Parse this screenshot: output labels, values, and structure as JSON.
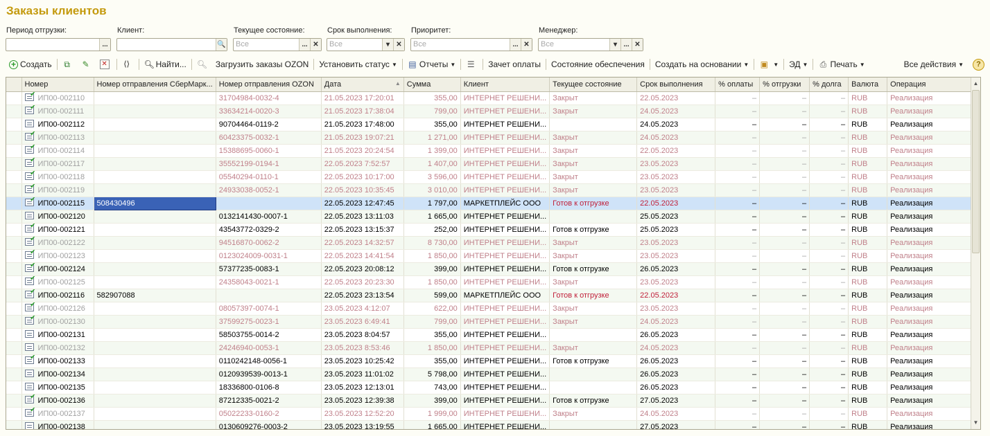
{
  "page": {
    "title": "Заказы клиентов"
  },
  "filters": [
    {
      "label": "Период отгрузки:",
      "value": "",
      "buttons": [
        "..."
      ]
    },
    {
      "label": "Клиент:",
      "value": "",
      "buttons": [
        "🔍"
      ]
    },
    {
      "label": "Текущее состояние:",
      "value": "Все",
      "buttons": [
        "...",
        "✕"
      ]
    },
    {
      "label": "Срок выполнения:",
      "value": "Все",
      "buttons": [
        "▾",
        "✕"
      ]
    },
    {
      "label": "Приоритет:",
      "value": "Все",
      "buttons": [
        "...",
        "✕"
      ]
    },
    {
      "label": "Менеджер:",
      "value": "Все",
      "buttons": [
        "▾",
        "...",
        "✕"
      ]
    }
  ],
  "toolbar": {
    "create": "Создать",
    "find": "Найти...",
    "load_ozon": "Загрузить заказы OZON",
    "set_status": "Установить статус",
    "reports": "Отчеты",
    "payment_offset": "Зачет оплаты",
    "supply_state": "Состояние обеспечения",
    "create_based": "Создать на основании",
    "ed": "ЭД",
    "print": "Печать",
    "all_actions": "Все действия",
    "help": "?"
  },
  "table": {
    "columns": [
      "Номер",
      "Номер отправления СберМарк...",
      "Номер отправления OZON",
      "Дата",
      "Сумма",
      "Клиент",
      "Текущее состояние",
      "Срок выполнения",
      "% оплаты",
      "% отгрузки",
      "% долга",
      "Валюта",
      "Операция"
    ],
    "rows": [
      {
        "icon": "done",
        "state": "gray",
        "number": "ИП00-002110",
        "sber": "",
        "ozon": "31704984-0032-4",
        "date": "21.05.2023 17:20:01",
        "sum": "355,00",
        "client": "ИНТЕРНЕТ РЕШЕНИ...",
        "status": "Закрыт",
        "due": "22.05.2023",
        "pay": "–",
        "ship": "–",
        "debt": "–",
        "currency": "RUB",
        "operation": "Реализация"
      },
      {
        "icon": "done",
        "state": "gray",
        "number": "ИП00-002111",
        "sber": "",
        "ozon": "33634214-0020-3",
        "date": "21.05.2023 17:38:04",
        "sum": "799,00",
        "client": "ИНТЕРНЕТ РЕШЕНИ...",
        "status": "Закрыт",
        "due": "24.05.2023",
        "pay": "–",
        "ship": "–",
        "debt": "–",
        "currency": "RUB",
        "operation": "Реализация"
      },
      {
        "icon": "doc",
        "state": "normal",
        "number": "ИП00-002112",
        "sber": "",
        "ozon": "90704464-0119-2",
        "date": "21.05.2023 17:48:00",
        "sum": "355,00",
        "client": "ИНТЕРНЕТ РЕШЕНИ...",
        "status": "",
        "due": "24.05.2023",
        "pay": "–",
        "ship": "–",
        "debt": "–",
        "currency": "RUB",
        "operation": "Реализация"
      },
      {
        "icon": "done",
        "state": "gray",
        "number": "ИП00-002113",
        "sber": "",
        "ozon": "60423375-0032-1",
        "date": "21.05.2023 19:07:21",
        "sum": "1 271,00",
        "client": "ИНТЕРНЕТ РЕШЕНИ...",
        "status": "Закрыт",
        "due": "24.05.2023",
        "pay": "–",
        "ship": "–",
        "debt": "–",
        "currency": "RUB",
        "operation": "Реализация"
      },
      {
        "icon": "done",
        "state": "gray",
        "number": "ИП00-002114",
        "sber": "",
        "ozon": "15388695-0060-1",
        "date": "21.05.2023 20:24:54",
        "sum": "1 399,00",
        "client": "ИНТЕРНЕТ РЕШЕНИ...",
        "status": "Закрыт",
        "due": "22.05.2023",
        "pay": "–",
        "ship": "–",
        "debt": "–",
        "currency": "RUB",
        "operation": "Реализация"
      },
      {
        "icon": "done",
        "state": "gray",
        "number": "ИП00-002117",
        "sber": "",
        "ozon": "35552199-0194-1",
        "date": "22.05.2023 7:52:57",
        "sum": "1 407,00",
        "client": "ИНТЕРНЕТ РЕШЕНИ...",
        "status": "Закрыт",
        "due": "23.05.2023",
        "pay": "–",
        "ship": "–",
        "debt": "–",
        "currency": "RUB",
        "operation": "Реализация"
      },
      {
        "icon": "done",
        "state": "gray",
        "number": "ИП00-002118",
        "sber": "",
        "ozon": "05540294-0110-1",
        "date": "22.05.2023 10:17:00",
        "sum": "3 596,00",
        "client": "ИНТЕРНЕТ РЕШЕНИ...",
        "status": "Закрыт",
        "due": "23.05.2023",
        "pay": "–",
        "ship": "–",
        "debt": "–",
        "currency": "RUB",
        "operation": "Реализация"
      },
      {
        "icon": "done",
        "state": "gray",
        "number": "ИП00-002119",
        "sber": "",
        "ozon": "24933038-0052-1",
        "date": "22.05.2023 10:35:45",
        "sum": "3 010,00",
        "client": "ИНТЕРНЕТ РЕШЕНИ...",
        "status": "Закрыт",
        "due": "23.05.2023",
        "pay": "–",
        "ship": "–",
        "debt": "–",
        "currency": "RUB",
        "operation": "Реализация"
      },
      {
        "icon": "done",
        "state": "selected",
        "number": "ИП00-002115",
        "sber": "508430496",
        "ozon": "",
        "date": "22.05.2023 12:47:45",
        "sum": "1 797,00",
        "client": "МАРКЕТПЛЕЙС ООО",
        "status": "Готов к отгрузке",
        "due": "22.05.2023",
        "red": true,
        "pay": "–",
        "ship": "–",
        "debt": "–",
        "currency": "RUB",
        "operation": "Реализация"
      },
      {
        "icon": "doc",
        "state": "normal",
        "number": "ИП00-002120",
        "sber": "",
        "ozon": "0132141430-0007-1",
        "date": "22.05.2023 13:11:03",
        "sum": "1 665,00",
        "client": "ИНТЕРНЕТ РЕШЕНИ...",
        "status": "",
        "due": "25.05.2023",
        "pay": "–",
        "ship": "–",
        "debt": "–",
        "currency": "RUB",
        "operation": "Реализация"
      },
      {
        "icon": "done",
        "state": "normal",
        "number": "ИП00-002121",
        "sber": "",
        "ozon": "43543772-0329-2",
        "date": "22.05.2023 13:15:37",
        "sum": "252,00",
        "client": "ИНТЕРНЕТ РЕШЕНИ...",
        "status": "Готов к отгрузке",
        "due": "25.05.2023",
        "pay": "–",
        "ship": "–",
        "debt": "–",
        "currency": "RUB",
        "operation": "Реализация"
      },
      {
        "icon": "done",
        "state": "gray",
        "number": "ИП00-002122",
        "sber": "",
        "ozon": "94516870-0062-2",
        "date": "22.05.2023 14:32:57",
        "sum": "8 730,00",
        "client": "ИНТЕРНЕТ РЕШЕНИ...",
        "status": "Закрыт",
        "due": "23.05.2023",
        "pay": "–",
        "ship": "–",
        "debt": "–",
        "currency": "RUB",
        "operation": "Реализация"
      },
      {
        "icon": "done",
        "state": "gray",
        "number": "ИП00-002123",
        "sber": "",
        "ozon": "0123024009-0031-1",
        "date": "22.05.2023 14:41:54",
        "sum": "1 850,00",
        "client": "ИНТЕРНЕТ РЕШЕНИ...",
        "status": "Закрыт",
        "due": "23.05.2023",
        "pay": "–",
        "ship": "–",
        "debt": "–",
        "currency": "RUB",
        "operation": "Реализация"
      },
      {
        "icon": "done",
        "state": "normal",
        "number": "ИП00-002124",
        "sber": "",
        "ozon": "57377235-0083-1",
        "date": "22.05.2023 20:08:12",
        "sum": "399,00",
        "client": "ИНТЕРНЕТ РЕШЕНИ...",
        "status": "Готов к отгрузке",
        "due": "26.05.2023",
        "pay": "–",
        "ship": "–",
        "debt": "–",
        "currency": "RUB",
        "operation": "Реализация"
      },
      {
        "icon": "done",
        "state": "gray",
        "number": "ИП00-002125",
        "sber": "",
        "ozon": "24358043-0021-1",
        "date": "22.05.2023 20:23:30",
        "sum": "1 850,00",
        "client": "ИНТЕРНЕТ РЕШЕНИ...",
        "status": "Закрыт",
        "due": "23.05.2023",
        "pay": "–",
        "ship": "–",
        "debt": "–",
        "currency": "RUB",
        "operation": "Реализация"
      },
      {
        "icon": "done",
        "state": "normal",
        "number": "ИП00-002116",
        "sber": "582907088",
        "ozon": "",
        "date": "22.05.2023 23:13:54",
        "sum": "599,00",
        "client": "МАРКЕТПЛЕЙС ООО",
        "status": "Готов к отгрузке",
        "due": "22.05.2023",
        "red": true,
        "pay": "–",
        "ship": "–",
        "debt": "–",
        "currency": "RUB",
        "operation": "Реализация"
      },
      {
        "icon": "done",
        "state": "gray",
        "number": "ИП00-002126",
        "sber": "",
        "ozon": "08057397-0074-1",
        "date": "23.05.2023 4:12:07",
        "sum": "622,00",
        "client": "ИНТЕРНЕТ РЕШЕНИ...",
        "status": "Закрыт",
        "due": "23.05.2023",
        "pay": "–",
        "ship": "–",
        "debt": "–",
        "currency": "RUB",
        "operation": "Реализация"
      },
      {
        "icon": "done",
        "state": "gray",
        "number": "ИП00-002130",
        "sber": "",
        "ozon": "37599275-0023-1",
        "date": "23.05.2023 6:49:41",
        "sum": "799,00",
        "client": "ИНТЕРНЕТ РЕШЕНИ...",
        "status": "Закрыт",
        "due": "24.05.2023",
        "pay": "–",
        "ship": "–",
        "debt": "–",
        "currency": "RUB",
        "operation": "Реализация"
      },
      {
        "icon": "doc",
        "state": "normal",
        "number": "ИП00-002131",
        "sber": "",
        "ozon": "58503755-0014-2",
        "date": "23.05.2023 8:04:57",
        "sum": "355,00",
        "client": "ИНТЕРНЕТ РЕШЕНИ...",
        "status": "",
        "due": "26.05.2023",
        "pay": "–",
        "ship": "–",
        "debt": "–",
        "currency": "RUB",
        "operation": "Реализация"
      },
      {
        "icon": "doc",
        "state": "gray",
        "number": "ИП00-002132",
        "sber": "",
        "ozon": "24246940-0053-1",
        "date": "23.05.2023 8:53:46",
        "sum": "1 850,00",
        "client": "ИНТЕРНЕТ РЕШЕНИ...",
        "status": "Закрыт",
        "due": "24.05.2023",
        "pay": "–",
        "ship": "–",
        "debt": "–",
        "currency": "RUB",
        "operation": "Реализация"
      },
      {
        "icon": "done",
        "state": "normal",
        "number": "ИП00-002133",
        "sber": "",
        "ozon": "0110242148-0056-1",
        "date": "23.05.2023 10:25:42",
        "sum": "355,00",
        "client": "ИНТЕРНЕТ РЕШЕНИ...",
        "status": "Готов к отгрузке",
        "due": "26.05.2023",
        "pay": "–",
        "ship": "–",
        "debt": "–",
        "currency": "RUB",
        "operation": "Реализация"
      },
      {
        "icon": "doc",
        "state": "normal",
        "number": "ИП00-002134",
        "sber": "",
        "ozon": "0120939539-0013-1",
        "date": "23.05.2023 11:01:02",
        "sum": "5 798,00",
        "client": "ИНТЕРНЕТ РЕШЕНИ...",
        "status": "",
        "due": "26.05.2023",
        "pay": "–",
        "ship": "–",
        "debt": "–",
        "currency": "RUB",
        "operation": "Реализация"
      },
      {
        "icon": "doc",
        "state": "normal",
        "number": "ИП00-002135",
        "sber": "",
        "ozon": "18336800-0106-8",
        "date": "23.05.2023 12:13:01",
        "sum": "743,00",
        "client": "ИНТЕРНЕТ РЕШЕНИ...",
        "status": "",
        "due": "26.05.2023",
        "pay": "–",
        "ship": "–",
        "debt": "–",
        "currency": "RUB",
        "operation": "Реализация"
      },
      {
        "icon": "done",
        "state": "normal",
        "number": "ИП00-002136",
        "sber": "",
        "ozon": "87212335-0021-2",
        "date": "23.05.2023 12:39:38",
        "sum": "399,00",
        "client": "ИНТЕРНЕТ РЕШЕНИ...",
        "status": "Готов к отгрузке",
        "due": "27.05.2023",
        "pay": "–",
        "ship": "–",
        "debt": "–",
        "currency": "RUB",
        "operation": "Реализация"
      },
      {
        "icon": "done",
        "state": "gray",
        "number": "ИП00-002137",
        "sber": "",
        "ozon": "05022233-0160-2",
        "date": "23.05.2023 12:52:20",
        "sum": "1 999,00",
        "client": "ИНТЕРНЕТ РЕШЕНИ...",
        "status": "Закрыт",
        "due": "24.05.2023",
        "pay": "–",
        "ship": "–",
        "debt": "–",
        "currency": "RUB",
        "operation": "Реализация"
      },
      {
        "icon": "doc",
        "state": "normal",
        "number": "ИП00-002138",
        "sber": "",
        "ozon": "0130609276-0003-2",
        "date": "23.05.2023 13:19:55",
        "sum": "1 665,00",
        "client": "ИНТЕРНЕТ РЕШЕНИ...",
        "status": "",
        "due": "27.05.2023",
        "pay": "–",
        "ship": "–",
        "debt": "–",
        "currency": "RUB",
        "operation": "Реализация"
      }
    ]
  }
}
